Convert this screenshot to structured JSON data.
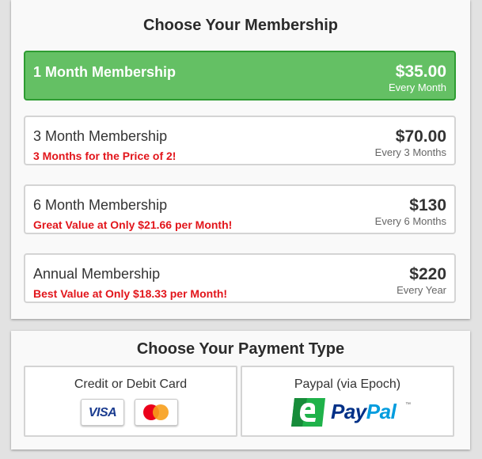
{
  "membership": {
    "title": "Choose Your Membership",
    "plans": [
      {
        "name": "1 Month Membership",
        "promo": "",
        "price": "$35.00",
        "period": "Every Month",
        "selected": true
      },
      {
        "name": "3 Month Membership",
        "promo": "3 Months for the Price of 2!",
        "price": "$70.00",
        "period": "Every 3 Months",
        "selected": false
      },
      {
        "name": "6 Month Membership",
        "promo": "Great Value at Only $21.66 per Month!",
        "price": "$130",
        "period": "Every 6 Months",
        "selected": false
      },
      {
        "name": "Annual Membership",
        "promo": "Best Value at Only $18.33 per Month!",
        "price": "$220",
        "period": "Every Year",
        "selected": false
      }
    ]
  },
  "payment": {
    "title": "Choose Your Payment Type",
    "options": [
      {
        "label": "Credit or Debit Card",
        "logos": [
          "visa-icon",
          "mastercard-icon"
        ],
        "visa_text": "VISA"
      },
      {
        "label": "Paypal (via Epoch)",
        "logos": [
          "epoch-icon",
          "paypal-icon"
        ],
        "paypal_a": "Pay",
        "paypal_b": "Pal",
        "trademark": "™"
      }
    ]
  },
  "colors": {
    "selected_bg": "#64c064",
    "selected_border": "#2e9c32",
    "promo": "#e2151b",
    "paypal_dark": "#003087",
    "paypal_light": "#009cde"
  }
}
